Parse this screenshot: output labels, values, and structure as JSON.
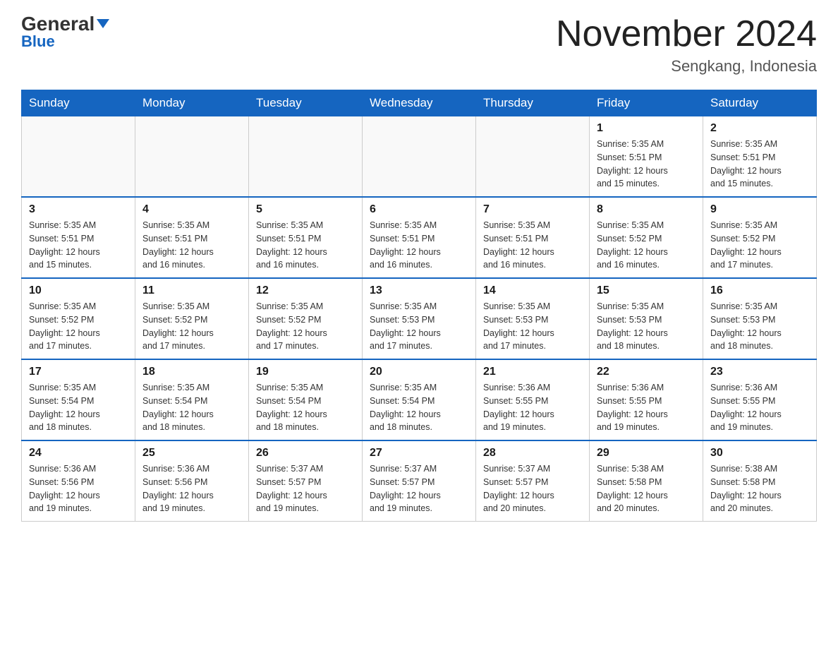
{
  "header": {
    "logo_general": "General",
    "logo_blue": "Blue",
    "month_title": "November 2024",
    "location": "Sengkang, Indonesia"
  },
  "days_of_week": [
    "Sunday",
    "Monday",
    "Tuesday",
    "Wednesday",
    "Thursday",
    "Friday",
    "Saturday"
  ],
  "weeks": [
    {
      "days": [
        {
          "number": "",
          "info": ""
        },
        {
          "number": "",
          "info": ""
        },
        {
          "number": "",
          "info": ""
        },
        {
          "number": "",
          "info": ""
        },
        {
          "number": "",
          "info": ""
        },
        {
          "number": "1",
          "info": "Sunrise: 5:35 AM\nSunset: 5:51 PM\nDaylight: 12 hours\nand 15 minutes."
        },
        {
          "number": "2",
          "info": "Sunrise: 5:35 AM\nSunset: 5:51 PM\nDaylight: 12 hours\nand 15 minutes."
        }
      ]
    },
    {
      "days": [
        {
          "number": "3",
          "info": "Sunrise: 5:35 AM\nSunset: 5:51 PM\nDaylight: 12 hours\nand 15 minutes."
        },
        {
          "number": "4",
          "info": "Sunrise: 5:35 AM\nSunset: 5:51 PM\nDaylight: 12 hours\nand 16 minutes."
        },
        {
          "number": "5",
          "info": "Sunrise: 5:35 AM\nSunset: 5:51 PM\nDaylight: 12 hours\nand 16 minutes."
        },
        {
          "number": "6",
          "info": "Sunrise: 5:35 AM\nSunset: 5:51 PM\nDaylight: 12 hours\nand 16 minutes."
        },
        {
          "number": "7",
          "info": "Sunrise: 5:35 AM\nSunset: 5:51 PM\nDaylight: 12 hours\nand 16 minutes."
        },
        {
          "number": "8",
          "info": "Sunrise: 5:35 AM\nSunset: 5:52 PM\nDaylight: 12 hours\nand 16 minutes."
        },
        {
          "number": "9",
          "info": "Sunrise: 5:35 AM\nSunset: 5:52 PM\nDaylight: 12 hours\nand 17 minutes."
        }
      ]
    },
    {
      "days": [
        {
          "number": "10",
          "info": "Sunrise: 5:35 AM\nSunset: 5:52 PM\nDaylight: 12 hours\nand 17 minutes."
        },
        {
          "number": "11",
          "info": "Sunrise: 5:35 AM\nSunset: 5:52 PM\nDaylight: 12 hours\nand 17 minutes."
        },
        {
          "number": "12",
          "info": "Sunrise: 5:35 AM\nSunset: 5:52 PM\nDaylight: 12 hours\nand 17 minutes."
        },
        {
          "number": "13",
          "info": "Sunrise: 5:35 AM\nSunset: 5:53 PM\nDaylight: 12 hours\nand 17 minutes."
        },
        {
          "number": "14",
          "info": "Sunrise: 5:35 AM\nSunset: 5:53 PM\nDaylight: 12 hours\nand 17 minutes."
        },
        {
          "number": "15",
          "info": "Sunrise: 5:35 AM\nSunset: 5:53 PM\nDaylight: 12 hours\nand 18 minutes."
        },
        {
          "number": "16",
          "info": "Sunrise: 5:35 AM\nSunset: 5:53 PM\nDaylight: 12 hours\nand 18 minutes."
        }
      ]
    },
    {
      "days": [
        {
          "number": "17",
          "info": "Sunrise: 5:35 AM\nSunset: 5:54 PM\nDaylight: 12 hours\nand 18 minutes."
        },
        {
          "number": "18",
          "info": "Sunrise: 5:35 AM\nSunset: 5:54 PM\nDaylight: 12 hours\nand 18 minutes."
        },
        {
          "number": "19",
          "info": "Sunrise: 5:35 AM\nSunset: 5:54 PM\nDaylight: 12 hours\nand 18 minutes."
        },
        {
          "number": "20",
          "info": "Sunrise: 5:35 AM\nSunset: 5:54 PM\nDaylight: 12 hours\nand 18 minutes."
        },
        {
          "number": "21",
          "info": "Sunrise: 5:36 AM\nSunset: 5:55 PM\nDaylight: 12 hours\nand 19 minutes."
        },
        {
          "number": "22",
          "info": "Sunrise: 5:36 AM\nSunset: 5:55 PM\nDaylight: 12 hours\nand 19 minutes."
        },
        {
          "number": "23",
          "info": "Sunrise: 5:36 AM\nSunset: 5:55 PM\nDaylight: 12 hours\nand 19 minutes."
        }
      ]
    },
    {
      "days": [
        {
          "number": "24",
          "info": "Sunrise: 5:36 AM\nSunset: 5:56 PM\nDaylight: 12 hours\nand 19 minutes."
        },
        {
          "number": "25",
          "info": "Sunrise: 5:36 AM\nSunset: 5:56 PM\nDaylight: 12 hours\nand 19 minutes."
        },
        {
          "number": "26",
          "info": "Sunrise: 5:37 AM\nSunset: 5:57 PM\nDaylight: 12 hours\nand 19 minutes."
        },
        {
          "number": "27",
          "info": "Sunrise: 5:37 AM\nSunset: 5:57 PM\nDaylight: 12 hours\nand 19 minutes."
        },
        {
          "number": "28",
          "info": "Sunrise: 5:37 AM\nSunset: 5:57 PM\nDaylight: 12 hours\nand 20 minutes."
        },
        {
          "number": "29",
          "info": "Sunrise: 5:38 AM\nSunset: 5:58 PM\nDaylight: 12 hours\nand 20 minutes."
        },
        {
          "number": "30",
          "info": "Sunrise: 5:38 AM\nSunset: 5:58 PM\nDaylight: 12 hours\nand 20 minutes."
        }
      ]
    }
  ]
}
